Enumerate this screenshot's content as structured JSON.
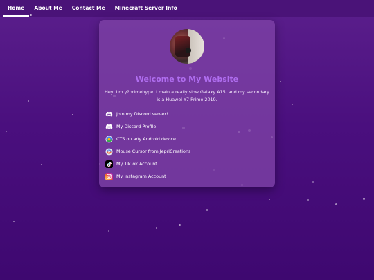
{
  "nav": {
    "items": [
      {
        "label": "Home"
      },
      {
        "label": "About Me"
      },
      {
        "label": "Contact Me"
      },
      {
        "label": "Minecraft Server Info"
      }
    ]
  },
  "card": {
    "title": "Welcome to My Website",
    "intro": "Hey, I'm y?primehype. I main a really slow Galaxy A15, and my secondary is a Huawei Y7 Prime 2019.",
    "links": [
      {
        "label": "Join my Discord server!",
        "icon": "discord-icon"
      },
      {
        "label": "My Discord Profile",
        "icon": "discord-icon"
      },
      {
        "label": "CTS on any Android device",
        "icon": "android-icon"
      },
      {
        "label": "Mouse Cursor from JepriCreations",
        "icon": "cursor-app-icon"
      },
      {
        "label": "My TikTok Account",
        "icon": "tiktok-icon"
      },
      {
        "label": "My Instagram Account",
        "icon": "instagram-icon"
      }
    ]
  },
  "colors": {
    "background": "#4a0f7e",
    "nav": "#4a1378",
    "card": "#7d41a5",
    "title": "#b06ef0"
  }
}
